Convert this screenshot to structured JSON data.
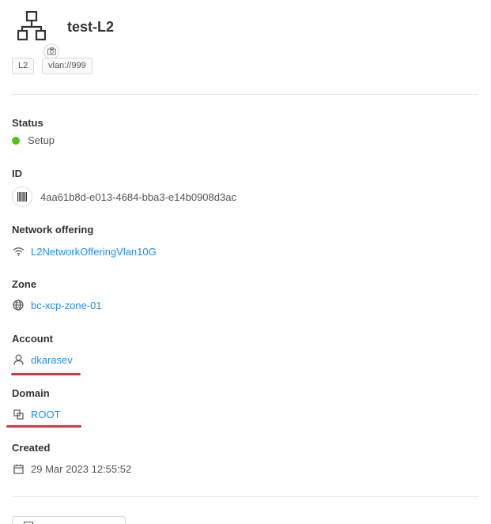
{
  "header": {
    "title": "test-L2",
    "tags": [
      "L2",
      "vlan://999"
    ]
  },
  "details": {
    "status": {
      "label": "Status",
      "value": "Setup",
      "color": "#52c41a"
    },
    "id": {
      "label": "ID",
      "value": "4aa61b8d-e013-4684-bba3-e14b0908d3ac"
    },
    "network_offering": {
      "label": "Network offering",
      "value": "L2NetworkOfferingVlan10G"
    },
    "zone": {
      "label": "Zone",
      "value": "bc-xcp-zone-01"
    },
    "account": {
      "label": "Account",
      "value": "dkarasev"
    },
    "domain": {
      "label": "Domain",
      "value": "ROOT"
    },
    "created": {
      "label": "Created",
      "value": "29 Mar 2023 12:55:52"
    }
  },
  "colors": {
    "link": "#1890ff",
    "highlight": "#d9363e"
  }
}
